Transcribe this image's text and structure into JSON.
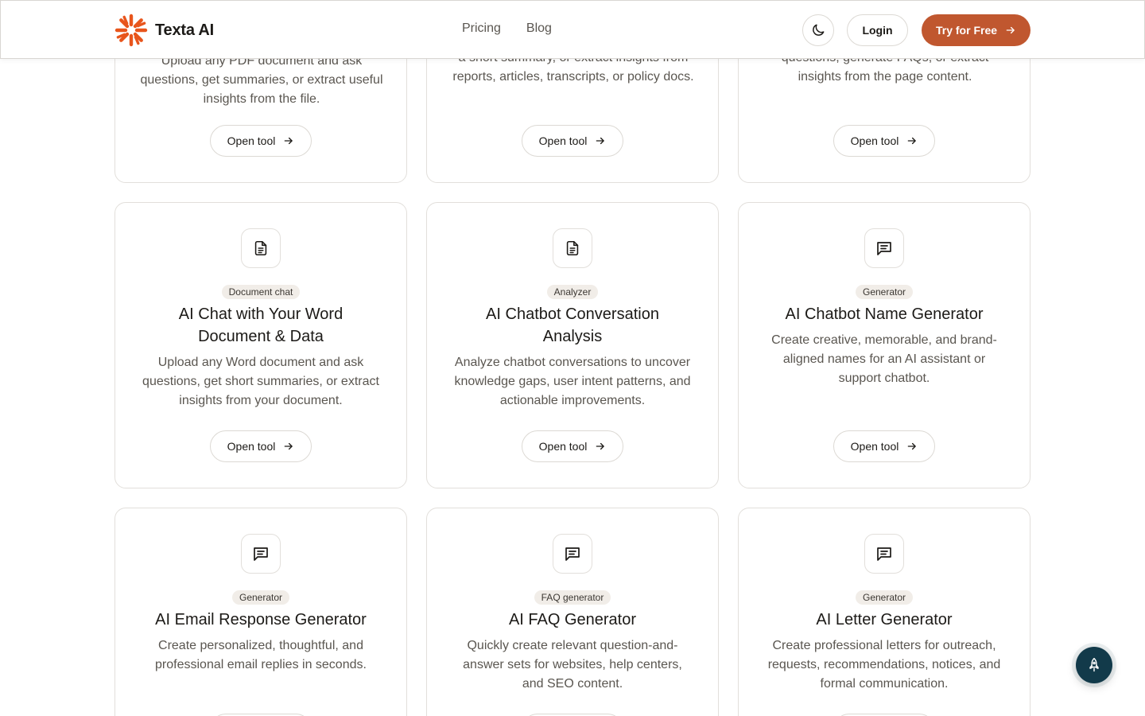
{
  "header": {
    "brand": "Texta AI",
    "nav": [
      {
        "label": "Pricing"
      },
      {
        "label": "Blog"
      }
    ],
    "login_label": "Login",
    "cta_label": "Try for Free",
    "brand_color": "#e8551c",
    "cta_color": "#c0572f"
  },
  "cards_top": [
    {
      "description": "Upload any PDF document and ask questions, get summaries, or extract useful insights from the file.",
      "button": "Open tool"
    },
    {
      "description": "a short summary, or extract insights from reports, articles, transcripts, or policy docs.",
      "button": "Open tool"
    },
    {
      "description": "questions, generate FAQs, or extract insights from the page content.",
      "button": "Open tool"
    }
  ],
  "cards_mid": [
    {
      "icon": "document-icon",
      "badge": "Document chat",
      "title": "AI Chat with Your Word Document & Data",
      "description": "Upload any Word document and ask questions, get short summaries, or extract insights from your document.",
      "button": "Open tool"
    },
    {
      "icon": "document-icon",
      "badge": "Analyzer",
      "title": "AI Chatbot Conversation Analysis",
      "description": "Analyze chatbot conversations to uncover knowledge gaps, user intent patterns, and actionable improvements.",
      "button": "Open tool"
    },
    {
      "icon": "message-icon",
      "badge": "Generator",
      "title": "AI Chatbot Name Generator",
      "description": "Create creative, memorable, and brand-aligned names for an AI assistant or support chatbot.",
      "button": "Open tool"
    }
  ],
  "cards_bottom": [
    {
      "icon": "message-icon",
      "badge": "Generator",
      "title": "AI Email Response Generator",
      "description": "Create personalized, thoughtful, and professional email replies in seconds."
    },
    {
      "icon": "message-icon",
      "badge": "FAQ generator",
      "title": "AI FAQ Generator",
      "description": "Quickly create relevant question-and-answer sets for websites, help centers, and SEO content."
    },
    {
      "icon": "message-icon",
      "badge": "Generator",
      "title": "AI Letter Generator",
      "description": "Create professional letters for outreach, requests, recommendations, notices, and formal communication."
    }
  ],
  "fab": {
    "icon": "rocket-icon",
    "color": "#123a4a"
  }
}
